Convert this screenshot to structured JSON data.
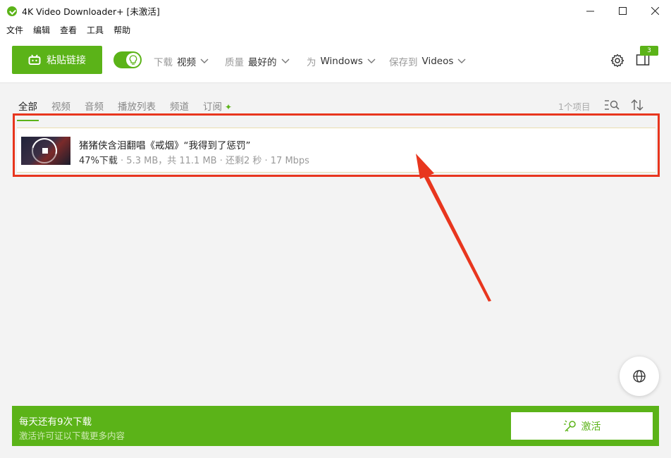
{
  "window": {
    "title": "4K Video Downloader+ [未激活]",
    "controls": {
      "minimize": "—",
      "maximize": "☐",
      "close": "✕"
    }
  },
  "menu": [
    "文件",
    "编辑",
    "查看",
    "工具",
    "帮助"
  ],
  "toolbar": {
    "paste_label": "粘贴链接",
    "smart_mode_on": true,
    "download": {
      "key": "下载",
      "value": "视频"
    },
    "quality": {
      "key": "质量",
      "value": "最好的"
    },
    "for": {
      "key": "为",
      "value": "Windows"
    },
    "save_to": {
      "key": "保存到",
      "value": "Videos"
    },
    "subscriptions_badge": "3"
  },
  "tabs": [
    {
      "label": "全部",
      "active": true
    },
    {
      "label": "视频",
      "active": false
    },
    {
      "label": "音频",
      "active": false
    },
    {
      "label": "播放列表",
      "active": false
    },
    {
      "label": "频道",
      "active": false
    },
    {
      "label": "订阅",
      "active": false
    }
  ],
  "list": {
    "count_label": "1个项目",
    "items": [
      {
        "title": "猪猪侠含泪翻唱《戒烟》“我得到了惩罚”",
        "progress_label": "47%下载",
        "details": " · 5.3 MB，共 11.1 MB · 还剩2 秒 · 17 Mbps",
        "progress": 0.47
      }
    ]
  },
  "banner": {
    "title": "每天还有9次下载",
    "subtitle": "激活许可证以下载更多内容",
    "activate_label": "激活"
  },
  "colors": {
    "accent": "#5bb318",
    "highlight": "#e8361e"
  }
}
